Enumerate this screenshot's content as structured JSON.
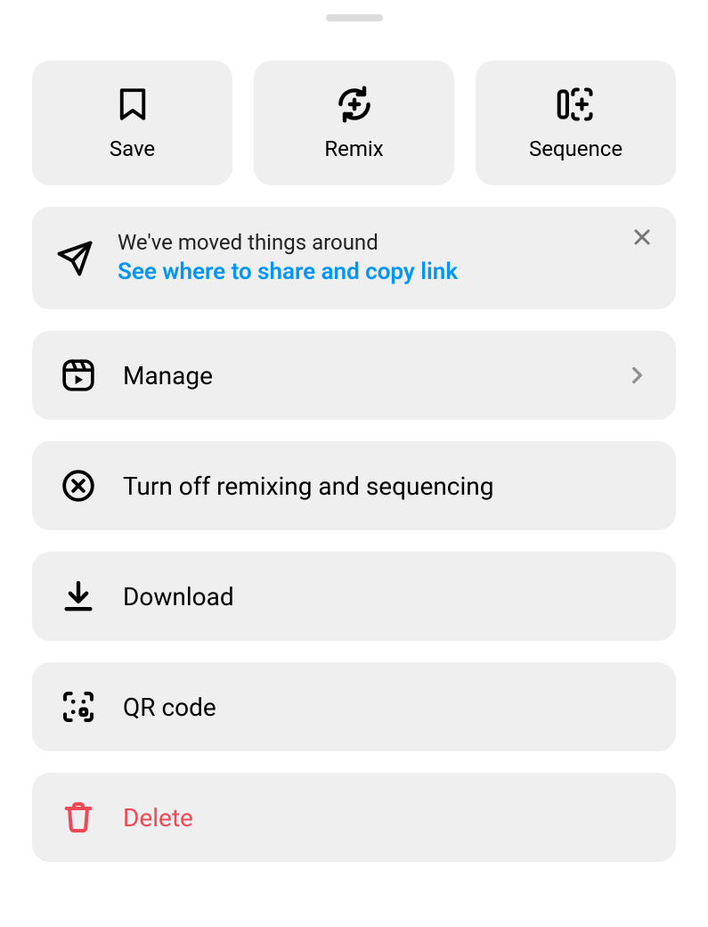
{
  "tiles": {
    "save": {
      "label": "Save"
    },
    "remix": {
      "label": "Remix"
    },
    "sequence": {
      "label": "Sequence"
    }
  },
  "banner": {
    "title": "We've moved things around",
    "link": "See where to share and copy link"
  },
  "rows": {
    "manage": {
      "label": "Manage"
    },
    "turnoff": {
      "label": "Turn off remixing and sequencing"
    },
    "download": {
      "label": "Download"
    },
    "qrcode": {
      "label": "QR code"
    },
    "delete": {
      "label": "Delete"
    }
  }
}
